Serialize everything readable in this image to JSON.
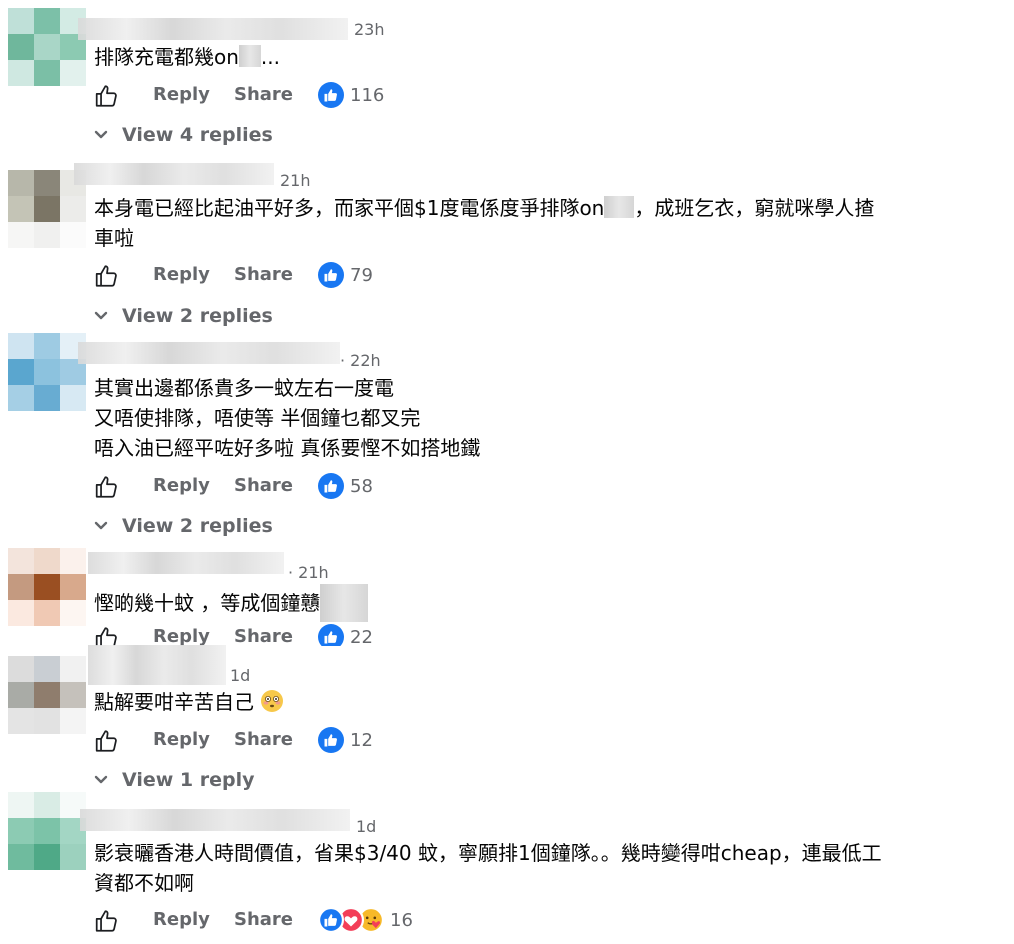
{
  "labels": {
    "reply": "Reply",
    "share": "Share"
  },
  "icons": {
    "like": "thumbs-up-outline-icon",
    "reaction_like": "blue-like-reaction-icon",
    "reaction_love": "red-heart-reaction-icon",
    "reaction_care": "care-hug-emoji-icon",
    "chevron": "chevron-down-icon",
    "emoji": "flushed-face-emoji-icon"
  },
  "colors": {
    "meta_text": "#65676b",
    "like_blue": "#1877f2",
    "love_red": "#f33e58",
    "body_text": "#050505"
  },
  "comments": [
    {
      "time": "23h",
      "text_line1": "排隊充電都幾on",
      "text_line1_tail": "...",
      "reaction_count": "116",
      "replies": "View 4 replies"
    },
    {
      "time": "21h",
      "text_line1": "本身電已經比起油平好多，而家平個$1度電係度爭排隊on",
      "text_line1_tail": "，成班乞衣，窮就咪學人揸",
      "text_line2": "車啦",
      "reaction_count": "79",
      "replies": "View 2 replies"
    },
    {
      "time": "· 22h",
      "text_line1": "其實出邊都係貴多一蚊左右一度電",
      "text_line2": "又唔使排隊，唔使等 半個鐘乜都叉完",
      "text_line3": "唔入油已經平咗好多啦 真係要慳不如搭地鐵",
      "reaction_count": "58",
      "replies": "View 2 replies"
    },
    {
      "time": "· 21h",
      "text_line1": "慳啲幾十蚊 ，等成個鐘戇",
      "reaction_count": "22"
    },
    {
      "time": "1d",
      "text_line1": "點解要咁辛苦自己",
      "reaction_count": "12",
      "replies": "View 1 reply"
    },
    {
      "time": "1d",
      "text_line1": "影衰曬香港人時間價值，省果$3/40 蚊，寧願排1個鐘隊。。幾時變得咁cheap，連最低工",
      "text_line2": "資都不如啊",
      "reaction_count": "16"
    }
  ]
}
